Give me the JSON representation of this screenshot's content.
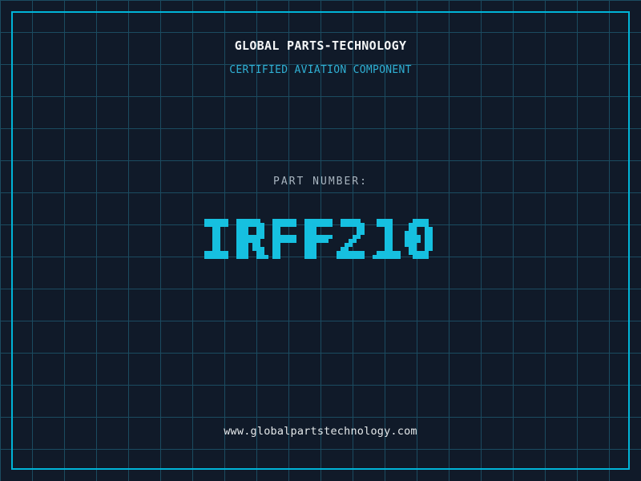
{
  "header": {
    "title": "GLOBAL PARTS-TECHNOLOGY",
    "subtitle": "CERTIFIED AVIATION COMPONENT"
  },
  "part": {
    "label": "PART NUMBER:",
    "number": "IRFF210"
  },
  "footer": {
    "url": "www.globalpartstechnology.com"
  },
  "grid": {
    "cell_size_px": 40
  },
  "colors": {
    "background": "#101a29",
    "grid_line": "#1b4b60",
    "frame": "#00b4d8",
    "title_text": "#f4f6f7",
    "subtitle_text": "#2fb0d4",
    "label_text": "#a8b4bf",
    "part_number_text": "#16c0e0",
    "footer_text": "#e4e8ea"
  }
}
